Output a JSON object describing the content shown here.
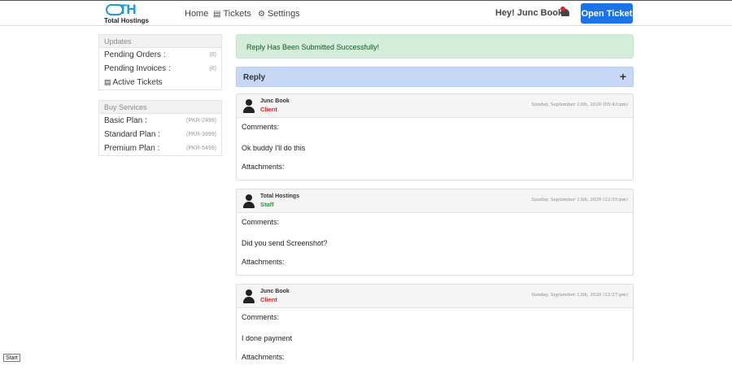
{
  "brand": {
    "mark": "TH",
    "name": "Total Hostings"
  },
  "nav": [
    {
      "label": "Home",
      "icon": ""
    },
    {
      "label": "Tickets",
      "icon": "ticket-icon"
    },
    {
      "label": "Settings",
      "icon": "gear-icon"
    }
  ],
  "header": {
    "greeting": "Hey! Junc Book",
    "open_ticket": "Open Ticket"
  },
  "sidebar": {
    "updates_title": "Updates",
    "updates": [
      {
        "label": "Pending Orders :",
        "value": "(0)"
      },
      {
        "label": "Pending Invoices :",
        "value": "(0)"
      },
      {
        "label": "Active Tickets",
        "value": ""
      }
    ],
    "services_title": "Buy Services",
    "services": [
      {
        "label": "Basic Plan :",
        "value": "(PKR-2499)"
      },
      {
        "label": "Standard Plan :",
        "value": "(PKR-3999)"
      },
      {
        "label": "Premium Plan :",
        "value": "(PKR-5499)"
      }
    ]
  },
  "alert": "Reply Has Been Submitted Successfully!",
  "reply": {
    "label": "Reply",
    "toggle": "+"
  },
  "messages": [
    {
      "name": "Junc Book",
      "role": "Client",
      "role_color": "#d62828",
      "date": "Sunday, September 13th, 2020 (05:43:pm)",
      "comments_label": "Comments:",
      "text": "Ok buddy I'll do this",
      "attachments_label": "Attachments:"
    },
    {
      "name": "Total Hostings",
      "role": "Staff",
      "role_color": "#2a9d3a",
      "date": "Sunday, September 13th, 2020 (12:55:pm)",
      "comments_label": "Comments:",
      "text": "Did you send Screenshot?",
      "attachments_label": "Attachments:"
    },
    {
      "name": "Junc Book",
      "role": "Client",
      "role_color": "#d62828",
      "date": "Sunday, September 13th, 2020 (12:27:pm)",
      "comments_label": "Comments:",
      "text": "I done payment",
      "attachments_label": "Attachments:"
    }
  ],
  "taskbar": {
    "start": "Start"
  },
  "colors": {
    "accent": "#1a73e8",
    "success_bg": "#d4edda",
    "reply_bg": "#c6d8f5"
  }
}
